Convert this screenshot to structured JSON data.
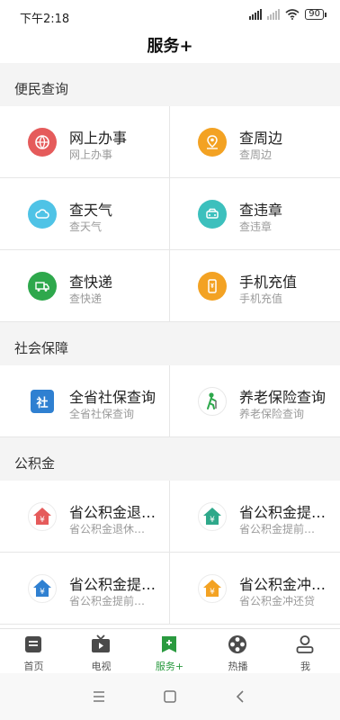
{
  "status": {
    "time": "下午2:18",
    "battery": "90"
  },
  "header": {
    "title": "服务+"
  },
  "sections": [
    {
      "title": "便民查询",
      "items": [
        {
          "title": "网上办事",
          "subtitle": "网上办事",
          "icon": "globe-icon",
          "color": "#e55b5b"
        },
        {
          "title": "查周边",
          "subtitle": "查周边",
          "icon": "location-icon",
          "color": "#f3a223"
        },
        {
          "title": "查天气",
          "subtitle": "查天气",
          "icon": "cloud-icon",
          "color": "#4fc3e6"
        },
        {
          "title": "查违章",
          "subtitle": "查违章",
          "icon": "car-icon",
          "color": "#3cc0bd"
        },
        {
          "title": "查快递",
          "subtitle": "查快递",
          "icon": "truck-icon",
          "color": "#2ea84c"
        },
        {
          "title": "手机充值",
          "subtitle": "手机充值",
          "icon": "phone-icon",
          "color": "#f3a223"
        }
      ]
    },
    {
      "title": "社会保障",
      "items": [
        {
          "title": "全省社保查询",
          "subtitle": "全省社保查询",
          "icon": "social-security-icon",
          "glyph": "社",
          "color": "#2f80d1"
        },
        {
          "title": "养老保险查询",
          "subtitle": "养老保险查询",
          "icon": "elderly-icon",
          "color": "#2ea84c"
        }
      ]
    },
    {
      "title": "公积金",
      "items": [
        {
          "title": "省公积金退…",
          "subtitle": "省公积金退休…",
          "icon": "house-yuan-icon",
          "glyph": "¥",
          "color": "#e55b5b"
        },
        {
          "title": "省公积金提…",
          "subtitle": "省公积金提前…",
          "icon": "house-yuan-icon",
          "glyph": "¥",
          "color": "#2ea88a"
        },
        {
          "title": "省公积金提…",
          "subtitle": "省公积金提前…",
          "icon": "house-yuan-icon",
          "glyph": "¥",
          "color": "#2f80d1"
        },
        {
          "title": "省公积金冲…",
          "subtitle": "省公积金冲还贷",
          "icon": "house-yuan-icon",
          "glyph": "¥",
          "color": "#f3a223"
        }
      ]
    }
  ],
  "tabs": [
    {
      "label": "首页",
      "icon": "home-icon"
    },
    {
      "label": "电视",
      "icon": "tv-icon"
    },
    {
      "label": "服务+",
      "icon": "service-icon",
      "active": true
    },
    {
      "label": "热播",
      "icon": "film-reel-icon"
    },
    {
      "label": "我",
      "icon": "profile-icon"
    }
  ],
  "colors": {
    "accent": "#2a9a3f"
  }
}
